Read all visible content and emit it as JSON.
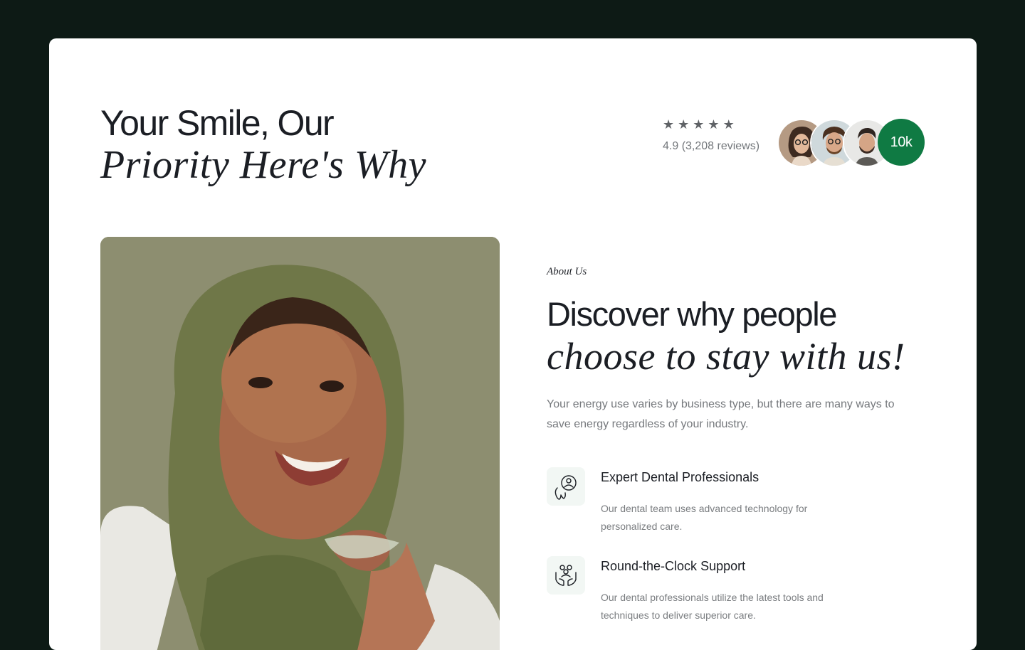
{
  "hero": {
    "title_line1": "Your Smile, Our",
    "title_line2": "Priority Here's Why"
  },
  "rating": {
    "stars": 5,
    "star_glyph": "★",
    "text": "4.9 (3,208 reviews)",
    "count_badge": "10k"
  },
  "about": {
    "eyebrow": "About Us",
    "title_line1": "Discover why people",
    "title_line2": "choose to stay with us!",
    "description": "Your energy use varies by business type, but there are many ways to save energy regardless of your industry."
  },
  "features": [
    {
      "icon": "dental-professional-icon",
      "title": "Expert Dental Professionals",
      "description": "Our dental team uses advanced technology for personalized care."
    },
    {
      "icon": "support-hands-icon",
      "title": "Round-the-Clock Support",
      "description": "Our dental professionals utilize the latest tools and techniques to deliver superior care."
    }
  ],
  "colors": {
    "page_background": "#0d1a15",
    "accent_green": "#0f7a43",
    "text_dark": "#1b1e24",
    "text_muted": "#76797d",
    "icon_tile": "#f2f7f4"
  }
}
